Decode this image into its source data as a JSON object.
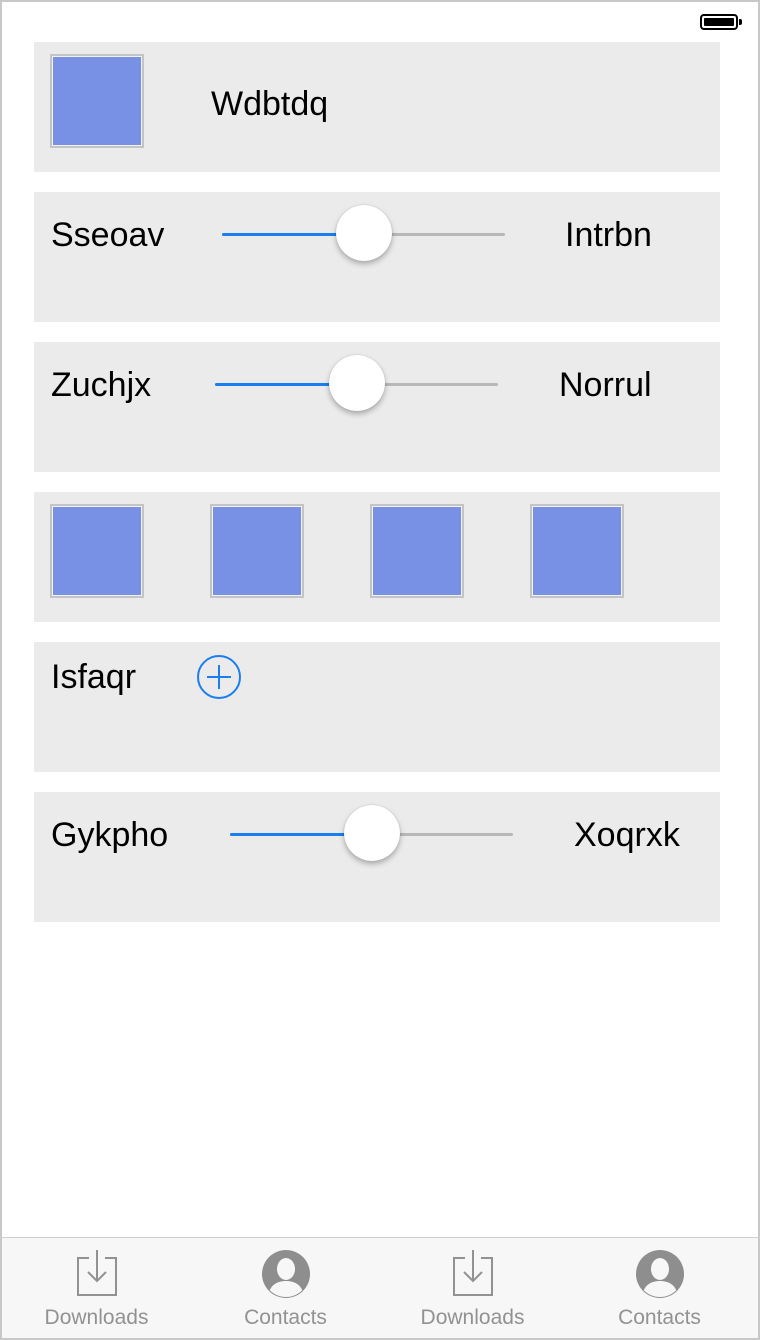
{
  "status_bar": {
    "battery_icon": "battery-full-icon"
  },
  "rows": [
    {
      "type": "image-label",
      "label": "Wdbtdq"
    },
    {
      "type": "slider",
      "left_label": "Sseoav",
      "right_label": "Intrbn",
      "value": 0.5
    },
    {
      "type": "slider",
      "left_label": "Zuchjx",
      "right_label": "Norrul",
      "value": 0.5
    },
    {
      "type": "image-grid",
      "image_count": 4
    },
    {
      "type": "add",
      "label": "Isfaqr",
      "icon": "add-circle-icon"
    },
    {
      "type": "slider",
      "left_label": "Gykpho",
      "right_label": "Xoqrxk",
      "value": 0.5
    }
  ],
  "colors": {
    "thumbnail": "#7891e4",
    "accent": "#1a7ef0",
    "cell_bg": "#ebebeb"
  },
  "tab_bar": {
    "tabs": [
      {
        "label": "Downloads",
        "icon": "downloads-icon"
      },
      {
        "label": "Contacts",
        "icon": "contacts-icon"
      },
      {
        "label": "Downloads",
        "icon": "downloads-icon"
      },
      {
        "label": "Contacts",
        "icon": "contacts-icon"
      }
    ]
  }
}
